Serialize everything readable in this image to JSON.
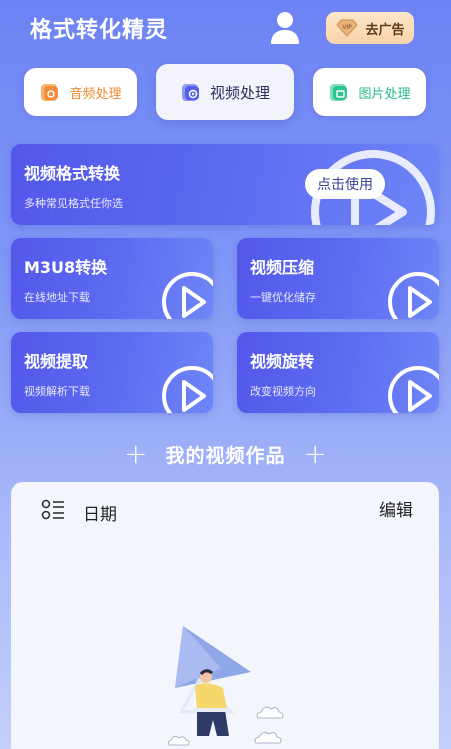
{
  "header": {
    "title": "格式转化精灵",
    "ad_badge": "VIP",
    "ad_label": "去广告"
  },
  "tabs": [
    {
      "label": "音频处理",
      "active": false
    },
    {
      "label": "视频处理",
      "active": true
    },
    {
      "label": "图片处理",
      "active": false
    }
  ],
  "feature_main": {
    "title": "视频格式转换",
    "subtitle": "多种常见格式任你选",
    "button": "点击使用"
  },
  "features": [
    {
      "title": "M3U8转换",
      "subtitle": "在线地址下载"
    },
    {
      "title": "视频压缩",
      "subtitle": "一键优化储存"
    },
    {
      "title": "视频提取",
      "subtitle": "视频解析下载"
    },
    {
      "title": "视频旋转",
      "subtitle": "改变视频方向"
    }
  ],
  "section": {
    "plus_left": "+",
    "title": "我的视频作品",
    "plus_right": "+"
  },
  "works": {
    "date_label": "日期",
    "edit_label": "编辑"
  },
  "colors": {
    "accent": "#5357ea",
    "audio": "#f08a2c",
    "image": "#26b88a",
    "ad_bg": "#f7d3a7"
  }
}
